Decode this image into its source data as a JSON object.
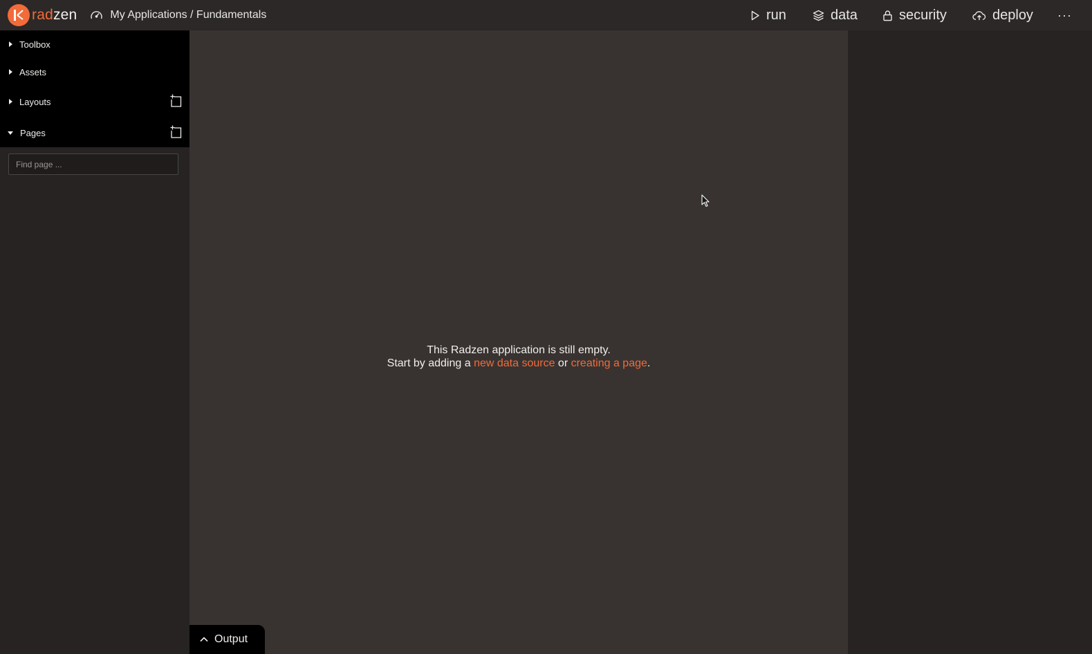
{
  "header": {
    "logo": {
      "part1": "rad",
      "part2": "zen",
      "icon": "radzen-logo-icon"
    },
    "breadcrumb": {
      "icon": "dashboard-gauge-icon",
      "text": "My Applications / Fundamentals"
    },
    "nav": [
      {
        "label": "run",
        "icon": "play-icon"
      },
      {
        "label": "data",
        "icon": "layers-icon"
      },
      {
        "label": "security",
        "icon": "lock-icon"
      },
      {
        "label": "deploy",
        "icon": "cloud-upload-icon"
      }
    ],
    "more": "···"
  },
  "sidebar": {
    "items": [
      {
        "label": "Toolbox",
        "expanded": false
      },
      {
        "label": "Assets",
        "expanded": false
      },
      {
        "label": "Layouts",
        "expanded": false,
        "add_icon": "new-layout-icon"
      },
      {
        "label": "Pages",
        "expanded": true,
        "add_icon": "new-page-icon"
      }
    ],
    "search": {
      "placeholder": "Find page ...",
      "value": ""
    }
  },
  "canvas": {
    "message_line1": "This Radzen application is still empty.",
    "message_prefix": "Start by adding a ",
    "link_data_source": "new data source",
    "message_or": " or ",
    "link_create_page": "creating a page",
    "message_suffix": "."
  },
  "output": {
    "label": "Output",
    "icon": "chevron-up-icon"
  },
  "colors": {
    "accent": "#f26b3a",
    "topbar": "#2b2827",
    "canvas": "#383331",
    "panel": "#262322",
    "accordion": "#000000"
  }
}
